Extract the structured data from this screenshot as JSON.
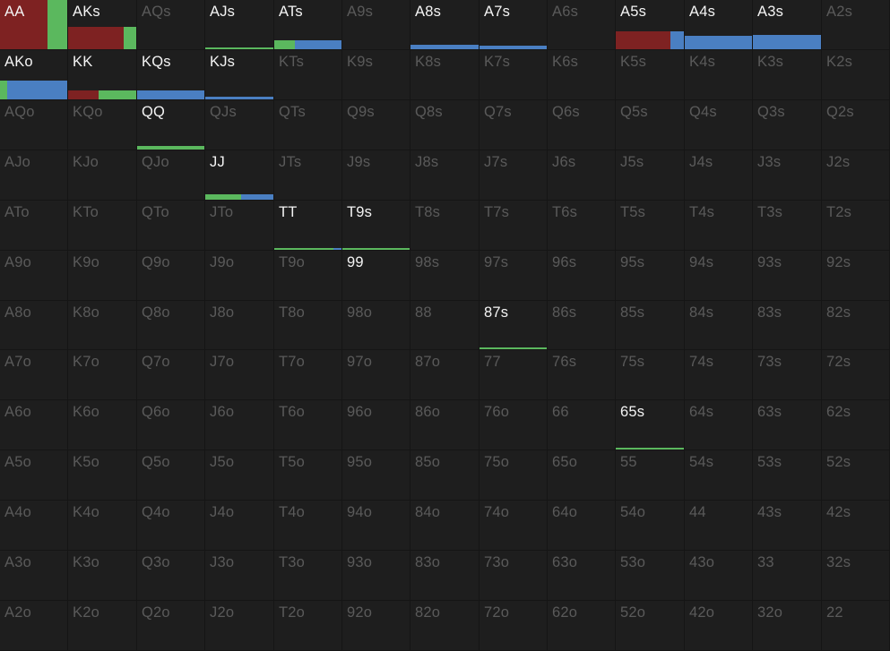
{
  "colors": {
    "raise": "#7e2222",
    "call": "#4a7fc2",
    "allin": "#5bb85e",
    "active_text": "#f4f4f4",
    "inactive_text": "#5a5a5a",
    "cell_bg": "#1e1e1e",
    "grid_line": "#151515"
  },
  "rows": [
    [
      {
        "hand": "AA",
        "active": true,
        "level": 1.0,
        "mix": [
          [
            "raise",
            0.7
          ],
          [
            "allin",
            0.3
          ]
        ]
      },
      {
        "hand": "AKs",
        "active": true,
        "level": 0.45,
        "mix": [
          [
            "raise",
            0.82
          ],
          [
            "allin",
            0.18
          ]
        ]
      },
      {
        "hand": "AQs",
        "active": false
      },
      {
        "hand": "AJs",
        "active": true,
        "level": 0.03,
        "mix": [
          [
            "allin",
            1.0
          ]
        ]
      },
      {
        "hand": "ATs",
        "active": true,
        "level": 0.18,
        "mix": [
          [
            "allin",
            0.3
          ],
          [
            "call",
            0.7
          ]
        ]
      },
      {
        "hand": "A9s",
        "active": false
      },
      {
        "hand": "A8s",
        "active": true,
        "level": 0.09,
        "mix": [
          [
            "call",
            1.0
          ]
        ]
      },
      {
        "hand": "A7s",
        "active": true,
        "level": 0.07,
        "mix": [
          [
            "call",
            1.0
          ]
        ]
      },
      {
        "hand": "A6s",
        "active": false
      },
      {
        "hand": "A5s",
        "active": true,
        "level": 0.36,
        "mix": [
          [
            "raise",
            0.8
          ],
          [
            "call",
            0.2
          ]
        ]
      },
      {
        "hand": "A4s",
        "active": true,
        "level": 0.27,
        "mix": [
          [
            "call",
            1.0
          ]
        ]
      },
      {
        "hand": "A3s",
        "active": true,
        "level": 0.29,
        "mix": [
          [
            "call",
            1.0
          ]
        ]
      },
      {
        "hand": "A2s",
        "active": false
      }
    ],
    [
      {
        "hand": "AKo",
        "active": true,
        "level": 0.38,
        "mix": [
          [
            "allin",
            0.11
          ],
          [
            "call",
            0.89
          ]
        ]
      },
      {
        "hand": "KK",
        "active": true,
        "level": 0.18,
        "mix": [
          [
            "raise",
            0.45
          ],
          [
            "allin",
            0.55
          ]
        ]
      },
      {
        "hand": "KQs",
        "active": true,
        "level": 0.18,
        "mix": [
          [
            "call",
            1.0
          ]
        ]
      },
      {
        "hand": "KJs",
        "active": true,
        "level": 0.05,
        "mix": [
          [
            "call",
            1.0
          ]
        ]
      },
      {
        "hand": "KTs",
        "active": false
      },
      {
        "hand": "K9s",
        "active": false
      },
      {
        "hand": "K8s",
        "active": false
      },
      {
        "hand": "K7s",
        "active": false
      },
      {
        "hand": "K6s",
        "active": false
      },
      {
        "hand": "K5s",
        "active": false
      },
      {
        "hand": "K4s",
        "active": false
      },
      {
        "hand": "K3s",
        "active": false
      },
      {
        "hand": "K2s",
        "active": false
      }
    ],
    [
      {
        "hand": "AQo",
        "active": false
      },
      {
        "hand": "KQo",
        "active": false
      },
      {
        "hand": "QQ",
        "active": true,
        "level": 0.07,
        "mix": [
          [
            "allin",
            1.0
          ]
        ]
      },
      {
        "hand": "QJs",
        "active": false
      },
      {
        "hand": "QTs",
        "active": false
      },
      {
        "hand": "Q9s",
        "active": false
      },
      {
        "hand": "Q8s",
        "active": false
      },
      {
        "hand": "Q7s",
        "active": false
      },
      {
        "hand": "Q6s",
        "active": false
      },
      {
        "hand": "Q5s",
        "active": false
      },
      {
        "hand": "Q4s",
        "active": false
      },
      {
        "hand": "Q3s",
        "active": false
      },
      {
        "hand": "Q2s",
        "active": false
      }
    ],
    [
      {
        "hand": "AJo",
        "active": false
      },
      {
        "hand": "KJo",
        "active": false
      },
      {
        "hand": "QJo",
        "active": false
      },
      {
        "hand": "JJ",
        "active": true,
        "level": 0.11,
        "mix": [
          [
            "allin",
            0.53
          ],
          [
            "call",
            0.47
          ]
        ]
      },
      {
        "hand": "JTs",
        "active": false
      },
      {
        "hand": "J9s",
        "active": false
      },
      {
        "hand": "J8s",
        "active": false
      },
      {
        "hand": "J7s",
        "active": false
      },
      {
        "hand": "J6s",
        "active": false
      },
      {
        "hand": "J5s",
        "active": false
      },
      {
        "hand": "J4s",
        "active": false
      },
      {
        "hand": "J3s",
        "active": false
      },
      {
        "hand": "J2s",
        "active": false
      }
    ],
    [
      {
        "hand": "ATo",
        "active": false
      },
      {
        "hand": "KTo",
        "active": false
      },
      {
        "hand": "QTo",
        "active": false
      },
      {
        "hand": "JTo",
        "active": false
      },
      {
        "hand": "TT",
        "active": true,
        "level": 0.04,
        "mix": [
          [
            "allin",
            0.88
          ],
          [
            "call",
            0.12
          ]
        ]
      },
      {
        "hand": "T9s",
        "active": true,
        "level": 0.02,
        "mix": [
          [
            "allin",
            1.0
          ]
        ]
      },
      {
        "hand": "T8s",
        "active": false
      },
      {
        "hand": "T7s",
        "active": false
      },
      {
        "hand": "T6s",
        "active": false
      },
      {
        "hand": "T5s",
        "active": false
      },
      {
        "hand": "T4s",
        "active": false
      },
      {
        "hand": "T3s",
        "active": false
      },
      {
        "hand": "T2s",
        "active": false
      }
    ],
    [
      {
        "hand": "A9o",
        "active": false
      },
      {
        "hand": "K9o",
        "active": false
      },
      {
        "hand": "Q9o",
        "active": false
      },
      {
        "hand": "J9o",
        "active": false
      },
      {
        "hand": "T9o",
        "active": false
      },
      {
        "hand": "99",
        "active": true,
        "level": 0.0
      },
      {
        "hand": "98s",
        "active": false
      },
      {
        "hand": "97s",
        "active": false
      },
      {
        "hand": "96s",
        "active": false
      },
      {
        "hand": "95s",
        "active": false
      },
      {
        "hand": "94s",
        "active": false
      },
      {
        "hand": "93s",
        "active": false
      },
      {
        "hand": "92s",
        "active": false
      }
    ],
    [
      {
        "hand": "A8o",
        "active": false
      },
      {
        "hand": "K8o",
        "active": false
      },
      {
        "hand": "Q8o",
        "active": false
      },
      {
        "hand": "J8o",
        "active": false
      },
      {
        "hand": "T8o",
        "active": false
      },
      {
        "hand": "98o",
        "active": false
      },
      {
        "hand": "88",
        "active": false
      },
      {
        "hand": "87s",
        "active": true,
        "level": 0.03,
        "mix": [
          [
            "allin",
            1.0
          ]
        ]
      },
      {
        "hand": "86s",
        "active": false
      },
      {
        "hand": "85s",
        "active": false
      },
      {
        "hand": "84s",
        "active": false
      },
      {
        "hand": "83s",
        "active": false
      },
      {
        "hand": "82s",
        "active": false
      }
    ],
    [
      {
        "hand": "A7o",
        "active": false
      },
      {
        "hand": "K7o",
        "active": false
      },
      {
        "hand": "Q7o",
        "active": false
      },
      {
        "hand": "J7o",
        "active": false
      },
      {
        "hand": "T7o",
        "active": false
      },
      {
        "hand": "97o",
        "active": false
      },
      {
        "hand": "87o",
        "active": false
      },
      {
        "hand": "77",
        "active": false
      },
      {
        "hand": "76s",
        "active": false
      },
      {
        "hand": "75s",
        "active": false
      },
      {
        "hand": "74s",
        "active": false
      },
      {
        "hand": "73s",
        "active": false
      },
      {
        "hand": "72s",
        "active": false
      }
    ],
    [
      {
        "hand": "A6o",
        "active": false
      },
      {
        "hand": "K6o",
        "active": false
      },
      {
        "hand": "Q6o",
        "active": false
      },
      {
        "hand": "J6o",
        "active": false
      },
      {
        "hand": "T6o",
        "active": false
      },
      {
        "hand": "96o",
        "active": false
      },
      {
        "hand": "86o",
        "active": false
      },
      {
        "hand": "76o",
        "active": false
      },
      {
        "hand": "66",
        "active": false
      },
      {
        "hand": "65s",
        "active": true,
        "level": 0.02,
        "mix": [
          [
            "allin",
            1.0
          ]
        ]
      },
      {
        "hand": "64s",
        "active": false
      },
      {
        "hand": "63s",
        "active": false
      },
      {
        "hand": "62s",
        "active": false
      }
    ],
    [
      {
        "hand": "A5o",
        "active": false
      },
      {
        "hand": "K5o",
        "active": false
      },
      {
        "hand": "Q5o",
        "active": false
      },
      {
        "hand": "J5o",
        "active": false
      },
      {
        "hand": "T5o",
        "active": false
      },
      {
        "hand": "95o",
        "active": false
      },
      {
        "hand": "85o",
        "active": false
      },
      {
        "hand": "75o",
        "active": false
      },
      {
        "hand": "65o",
        "active": false
      },
      {
        "hand": "55",
        "active": false
      },
      {
        "hand": "54s",
        "active": false
      },
      {
        "hand": "53s",
        "active": false
      },
      {
        "hand": "52s",
        "active": false
      }
    ],
    [
      {
        "hand": "A4o",
        "active": false
      },
      {
        "hand": "K4o",
        "active": false
      },
      {
        "hand": "Q4o",
        "active": false
      },
      {
        "hand": "J4o",
        "active": false
      },
      {
        "hand": "T4o",
        "active": false
      },
      {
        "hand": "94o",
        "active": false
      },
      {
        "hand": "84o",
        "active": false
      },
      {
        "hand": "74o",
        "active": false
      },
      {
        "hand": "64o",
        "active": false
      },
      {
        "hand": "54o",
        "active": false
      },
      {
        "hand": "44",
        "active": false
      },
      {
        "hand": "43s",
        "active": false
      },
      {
        "hand": "42s",
        "active": false
      }
    ],
    [
      {
        "hand": "A3o",
        "active": false
      },
      {
        "hand": "K3o",
        "active": false
      },
      {
        "hand": "Q3o",
        "active": false
      },
      {
        "hand": "J3o",
        "active": false
      },
      {
        "hand": "T3o",
        "active": false
      },
      {
        "hand": "93o",
        "active": false
      },
      {
        "hand": "83o",
        "active": false
      },
      {
        "hand": "73o",
        "active": false
      },
      {
        "hand": "63o",
        "active": false
      },
      {
        "hand": "53o",
        "active": false
      },
      {
        "hand": "43o",
        "active": false
      },
      {
        "hand": "33",
        "active": false
      },
      {
        "hand": "32s",
        "active": false
      }
    ],
    [
      {
        "hand": "A2o",
        "active": false
      },
      {
        "hand": "K2o",
        "active": false
      },
      {
        "hand": "Q2o",
        "active": false
      },
      {
        "hand": "J2o",
        "active": false
      },
      {
        "hand": "T2o",
        "active": false
      },
      {
        "hand": "92o",
        "active": false
      },
      {
        "hand": "82o",
        "active": false
      },
      {
        "hand": "72o",
        "active": false
      },
      {
        "hand": "62o",
        "active": false
      },
      {
        "hand": "52o",
        "active": false
      },
      {
        "hand": "42o",
        "active": false
      },
      {
        "hand": "32o",
        "active": false
      },
      {
        "hand": "22",
        "active": false
      }
    ]
  ]
}
